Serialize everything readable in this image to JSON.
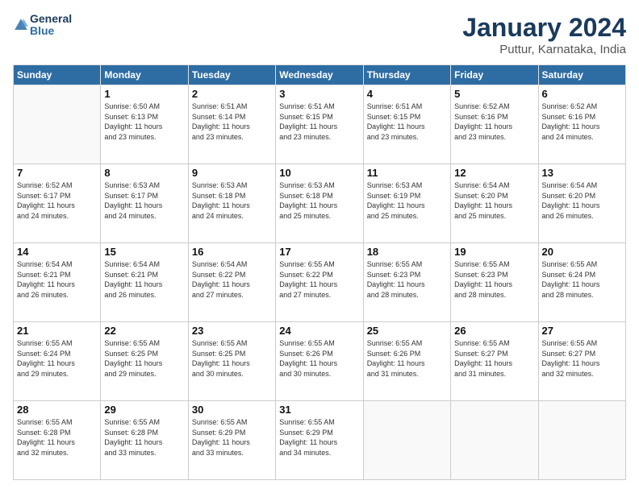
{
  "logo": {
    "text_general": "General",
    "text_blue": "Blue"
  },
  "header": {
    "month_year": "January 2024",
    "location": "Puttur, Karnataka, India"
  },
  "weekdays": [
    "Sunday",
    "Monday",
    "Tuesday",
    "Wednesday",
    "Thursday",
    "Friday",
    "Saturday"
  ],
  "weeks": [
    [
      {
        "day": "",
        "info": ""
      },
      {
        "day": "1",
        "info": "Sunrise: 6:50 AM\nSunset: 6:13 PM\nDaylight: 11 hours\nand 23 minutes."
      },
      {
        "day": "2",
        "info": "Sunrise: 6:51 AM\nSunset: 6:14 PM\nDaylight: 11 hours\nand 23 minutes."
      },
      {
        "day": "3",
        "info": "Sunrise: 6:51 AM\nSunset: 6:15 PM\nDaylight: 11 hours\nand 23 minutes."
      },
      {
        "day": "4",
        "info": "Sunrise: 6:51 AM\nSunset: 6:15 PM\nDaylight: 11 hours\nand 23 minutes."
      },
      {
        "day": "5",
        "info": "Sunrise: 6:52 AM\nSunset: 6:16 PM\nDaylight: 11 hours\nand 23 minutes."
      },
      {
        "day": "6",
        "info": "Sunrise: 6:52 AM\nSunset: 6:16 PM\nDaylight: 11 hours\nand 24 minutes."
      }
    ],
    [
      {
        "day": "7",
        "info": "Sunrise: 6:52 AM\nSunset: 6:17 PM\nDaylight: 11 hours\nand 24 minutes."
      },
      {
        "day": "8",
        "info": "Sunrise: 6:53 AM\nSunset: 6:17 PM\nDaylight: 11 hours\nand 24 minutes."
      },
      {
        "day": "9",
        "info": "Sunrise: 6:53 AM\nSunset: 6:18 PM\nDaylight: 11 hours\nand 24 minutes."
      },
      {
        "day": "10",
        "info": "Sunrise: 6:53 AM\nSunset: 6:18 PM\nDaylight: 11 hours\nand 25 minutes."
      },
      {
        "day": "11",
        "info": "Sunrise: 6:53 AM\nSunset: 6:19 PM\nDaylight: 11 hours\nand 25 minutes."
      },
      {
        "day": "12",
        "info": "Sunrise: 6:54 AM\nSunset: 6:20 PM\nDaylight: 11 hours\nand 25 minutes."
      },
      {
        "day": "13",
        "info": "Sunrise: 6:54 AM\nSunset: 6:20 PM\nDaylight: 11 hours\nand 26 minutes."
      }
    ],
    [
      {
        "day": "14",
        "info": "Sunrise: 6:54 AM\nSunset: 6:21 PM\nDaylight: 11 hours\nand 26 minutes."
      },
      {
        "day": "15",
        "info": "Sunrise: 6:54 AM\nSunset: 6:21 PM\nDaylight: 11 hours\nand 26 minutes."
      },
      {
        "day": "16",
        "info": "Sunrise: 6:54 AM\nSunset: 6:22 PM\nDaylight: 11 hours\nand 27 minutes."
      },
      {
        "day": "17",
        "info": "Sunrise: 6:55 AM\nSunset: 6:22 PM\nDaylight: 11 hours\nand 27 minutes."
      },
      {
        "day": "18",
        "info": "Sunrise: 6:55 AM\nSunset: 6:23 PM\nDaylight: 11 hours\nand 28 minutes."
      },
      {
        "day": "19",
        "info": "Sunrise: 6:55 AM\nSunset: 6:23 PM\nDaylight: 11 hours\nand 28 minutes."
      },
      {
        "day": "20",
        "info": "Sunrise: 6:55 AM\nSunset: 6:24 PM\nDaylight: 11 hours\nand 28 minutes."
      }
    ],
    [
      {
        "day": "21",
        "info": "Sunrise: 6:55 AM\nSunset: 6:24 PM\nDaylight: 11 hours\nand 29 minutes."
      },
      {
        "day": "22",
        "info": "Sunrise: 6:55 AM\nSunset: 6:25 PM\nDaylight: 11 hours\nand 29 minutes."
      },
      {
        "day": "23",
        "info": "Sunrise: 6:55 AM\nSunset: 6:25 PM\nDaylight: 11 hours\nand 30 minutes."
      },
      {
        "day": "24",
        "info": "Sunrise: 6:55 AM\nSunset: 6:26 PM\nDaylight: 11 hours\nand 30 minutes."
      },
      {
        "day": "25",
        "info": "Sunrise: 6:55 AM\nSunset: 6:26 PM\nDaylight: 11 hours\nand 31 minutes."
      },
      {
        "day": "26",
        "info": "Sunrise: 6:55 AM\nSunset: 6:27 PM\nDaylight: 11 hours\nand 31 minutes."
      },
      {
        "day": "27",
        "info": "Sunrise: 6:55 AM\nSunset: 6:27 PM\nDaylight: 11 hours\nand 32 minutes."
      }
    ],
    [
      {
        "day": "28",
        "info": "Sunrise: 6:55 AM\nSunset: 6:28 PM\nDaylight: 11 hours\nand 32 minutes."
      },
      {
        "day": "29",
        "info": "Sunrise: 6:55 AM\nSunset: 6:28 PM\nDaylight: 11 hours\nand 33 minutes."
      },
      {
        "day": "30",
        "info": "Sunrise: 6:55 AM\nSunset: 6:29 PM\nDaylight: 11 hours\nand 33 minutes."
      },
      {
        "day": "31",
        "info": "Sunrise: 6:55 AM\nSunset: 6:29 PM\nDaylight: 11 hours\nand 34 minutes."
      },
      {
        "day": "",
        "info": ""
      },
      {
        "day": "",
        "info": ""
      },
      {
        "day": "",
        "info": ""
      }
    ]
  ]
}
